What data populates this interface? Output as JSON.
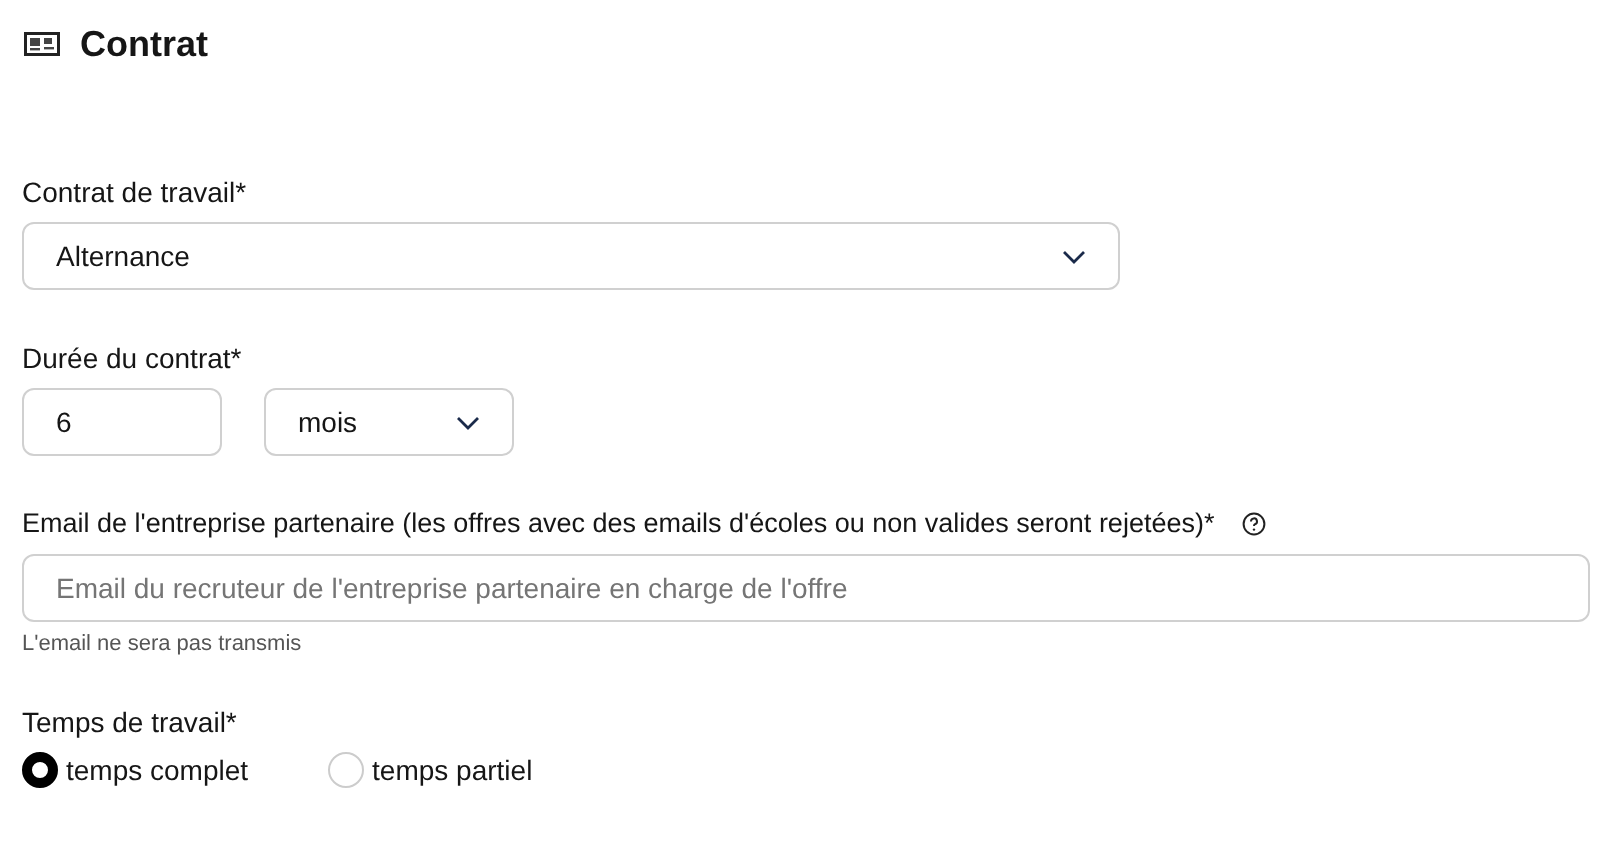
{
  "section": {
    "title": "Contrat"
  },
  "contract_type": {
    "label": "Contrat de travail*",
    "value": "Alternance"
  },
  "duration": {
    "label": "Durée du contrat*",
    "value": "6",
    "unit": "mois"
  },
  "email": {
    "label": "Email de l'entreprise partenaire (les offres avec des emails d'écoles ou non valides seront rejetées)*",
    "placeholder": "Email du recruteur de l'entreprise partenaire en charge de l'offre",
    "hint": "L'email ne sera pas transmis"
  },
  "work_time": {
    "label": "Temps de travail*",
    "options": [
      {
        "label": "temps complet",
        "selected": true
      },
      {
        "label": "temps partiel",
        "selected": false
      }
    ]
  }
}
